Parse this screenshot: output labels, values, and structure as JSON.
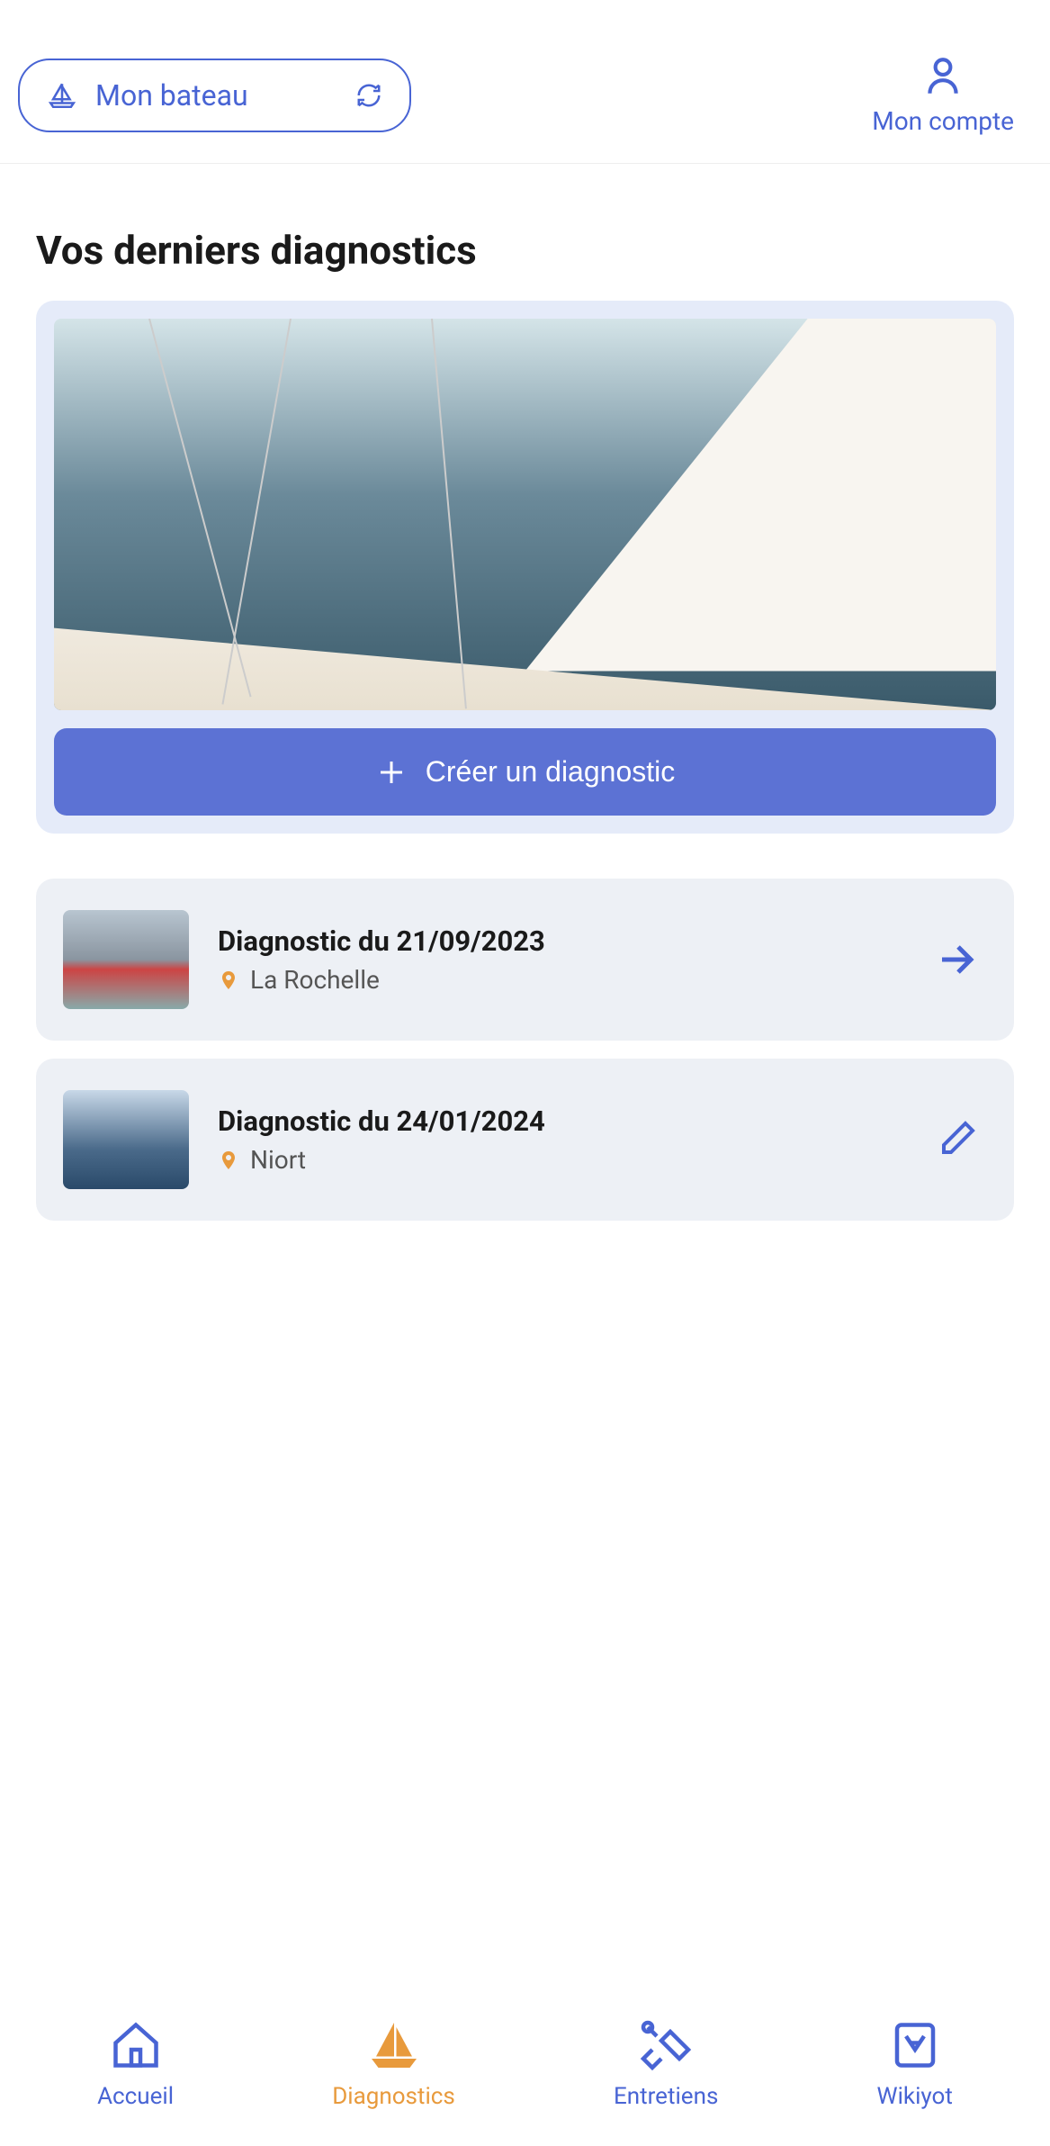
{
  "header": {
    "boat_label": "Mon bateau",
    "account_label": "Mon compte"
  },
  "main": {
    "title": "Vos derniers diagnostics",
    "create_button": "Créer un diagnostic"
  },
  "diagnostics": [
    {
      "title": "Diagnostic du 21/09/2023",
      "location": "La Rochelle",
      "action": "arrow"
    },
    {
      "title": "Diagnostic du 24/01/2024",
      "location": "Niort",
      "action": "edit"
    }
  ],
  "nav": {
    "home": "Accueil",
    "diagnostics": "Diagnostics",
    "maintenance": "Entretiens",
    "wiki": "Wikiyot"
  },
  "colors": {
    "primary": "#4864d4",
    "accent": "#e89a3c",
    "card_bg": "#edf0f5",
    "hero_bg": "#e5ebf9"
  }
}
